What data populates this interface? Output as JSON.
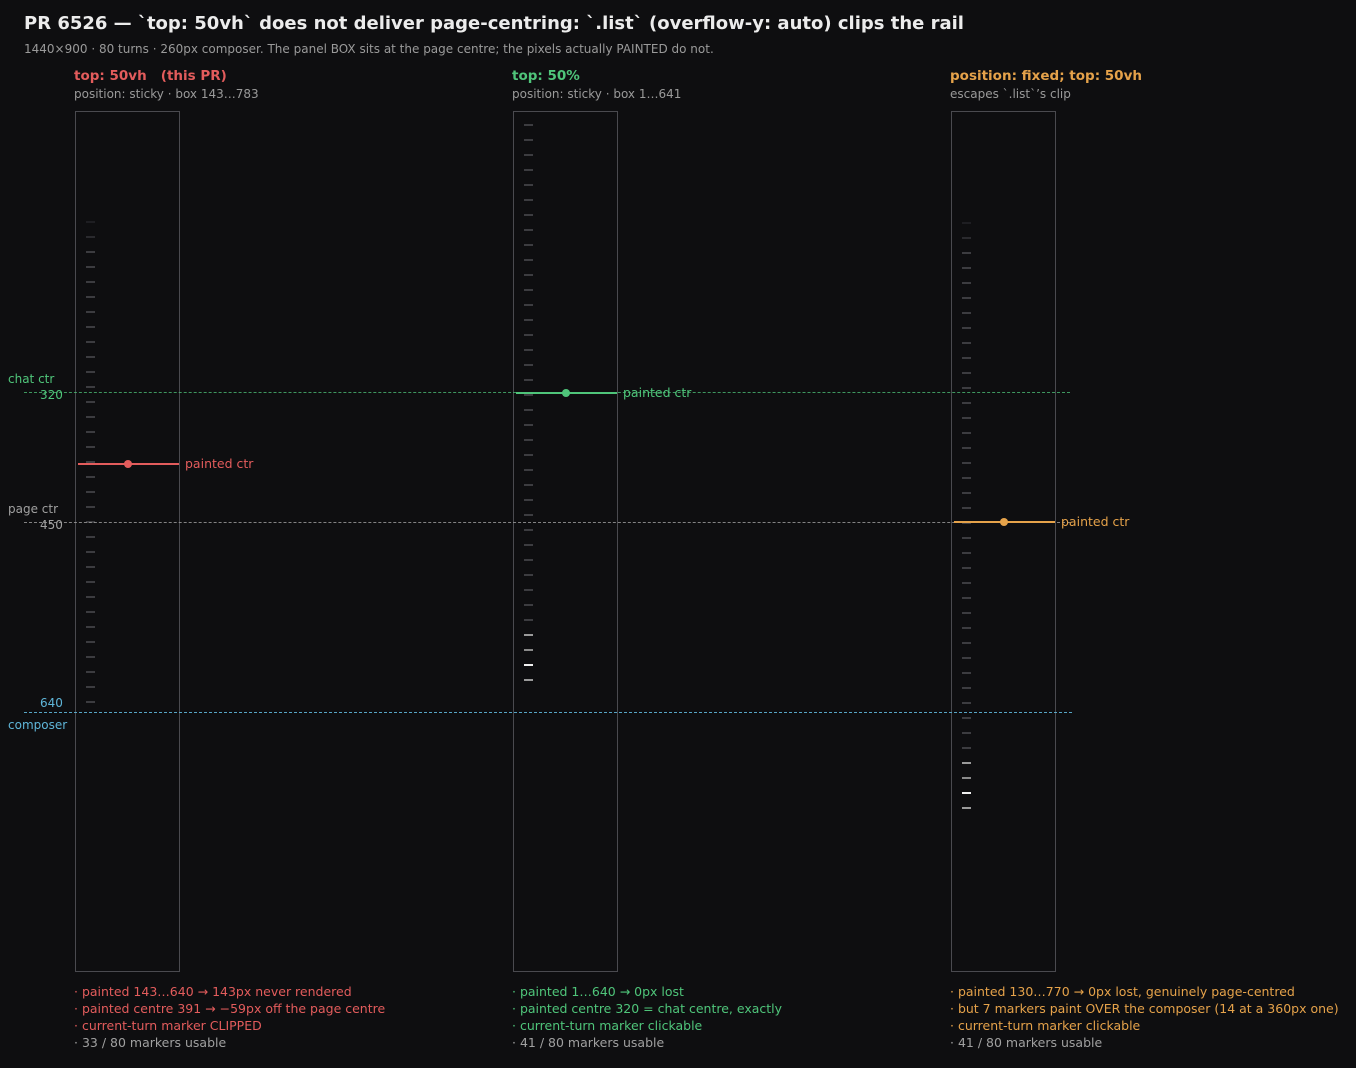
{
  "title": "PR 6526 — `top: 50vh` does not deliver page-centring: `.list` (overflow-y: auto) clips the rail",
  "subtitle": "1440×900 · 80 turns · 260px composer.  The panel BOX sits at the page centre; the pixels actually PAINTED do not.",
  "colors": {
    "red": "#e35c5c",
    "green": "#4fc57a",
    "orange": "#e5a24a",
    "blue": "#5fb6d9",
    "gray": "#a0a0a0"
  },
  "axis": {
    "chat_ctr": {
      "label": "chat ctr",
      "value": "320"
    },
    "page_ctr": {
      "label": "page ctr",
      "value": "450"
    },
    "composer": {
      "label": "composer",
      "value": "640"
    }
  },
  "columns": [
    {
      "title": "top: 50vh   (this PR)",
      "sub": "position: sticky · box 143…783",
      "painted_label": "painted ctr",
      "painted_centre": 391,
      "notes": [
        "·  painted 143…640  →  143px never rendered",
        "·  painted centre 391  →  −59px off the page centre",
        "·  current-turn marker CLIPPED",
        "·  33 / 80 markers usable"
      ]
    },
    {
      "title": "top: 50%",
      "sub": "position: sticky · box 1…641",
      "painted_label": "painted ctr",
      "painted_centre": 320,
      "notes": [
        "·  painted 1…640  →  0px lost",
        "·  painted centre 320  =  chat centre, exactly",
        "·  current-turn marker clickable",
        "·  41 / 80 markers usable"
      ]
    },
    {
      "title": "position: fixed; top: 50vh",
      "sub": "escapes `.list`’s clip",
      "painted_label": "painted ctr",
      "painted_centre": 450,
      "notes": [
        "·  painted 130…770  →  0px lost, genuinely page-centred",
        "·  but 7 markers paint OVER the composer (14 at a 360px one)",
        "·  current-turn marker clickable",
        "·  41 / 80 markers usable"
      ]
    }
  ]
}
